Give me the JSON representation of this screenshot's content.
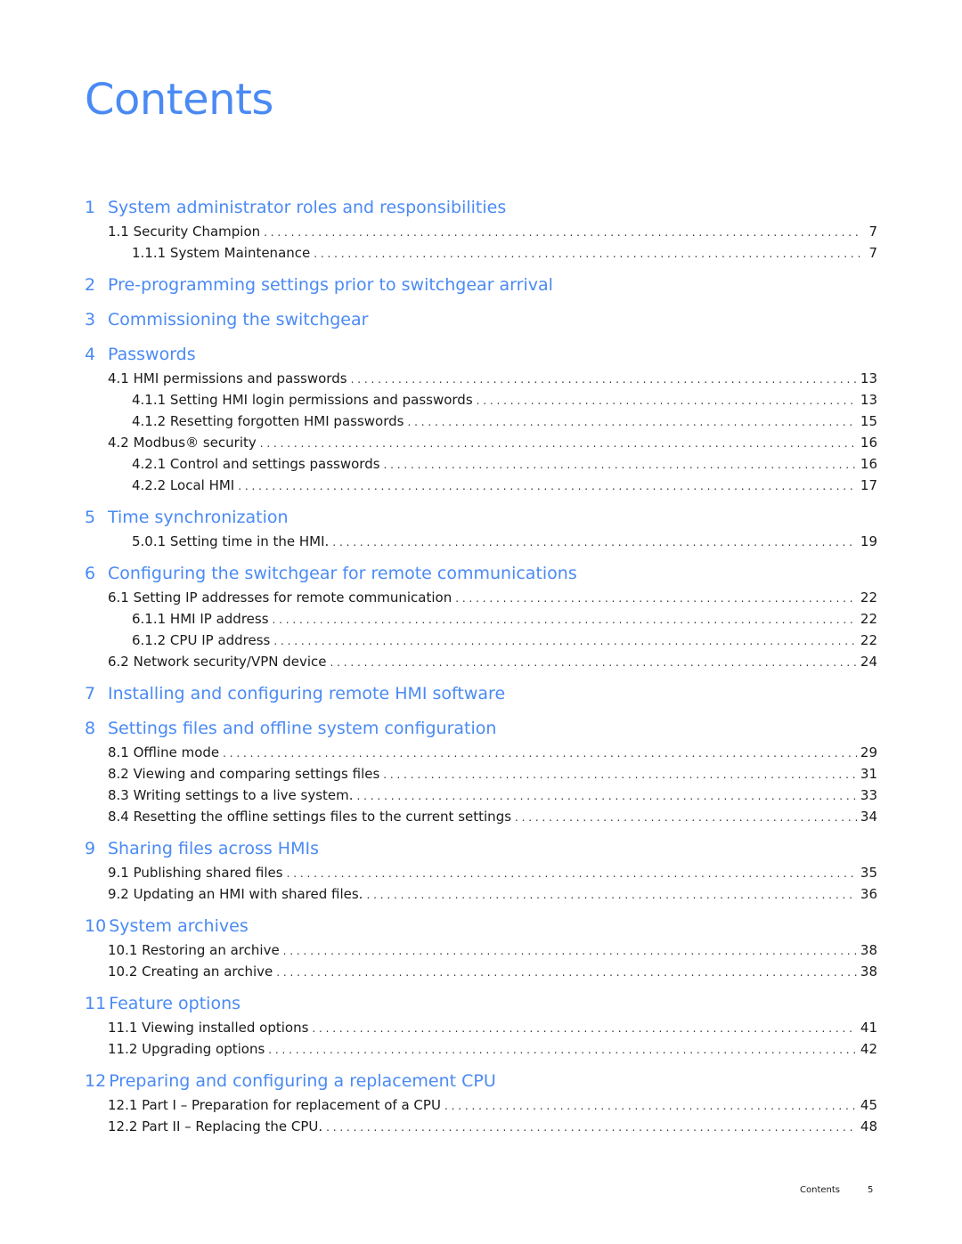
{
  "page_title": "Contents",
  "toc": [
    {
      "num": "1",
      "title": "System administrator roles and responsibilities",
      "entries": [
        {
          "level": 2,
          "label": "1.1 Security Champion",
          "page": "7"
        },
        {
          "level": 3,
          "label": "1.1.1 System Maintenance",
          "page": "7"
        }
      ]
    },
    {
      "num": "2",
      "title": "Pre-programming settings prior to switchgear arrival",
      "entries": []
    },
    {
      "num": "3",
      "title": "Commissioning the switchgear",
      "entries": []
    },
    {
      "num": "4",
      "title": "Passwords",
      "entries": [
        {
          "level": 2,
          "label": "4.1 HMI permissions and passwords",
          "page": "13"
        },
        {
          "level": 3,
          "label": "4.1.1 Setting HMI login permissions and passwords",
          "page": "13"
        },
        {
          "level": 3,
          "label": "4.1.2 Resetting forgotten HMI passwords",
          "page": "15"
        },
        {
          "level": 2,
          "label": "4.2 Modbus® security",
          "page": "16"
        },
        {
          "level": 3,
          "label": "4.2.1 Control and settings passwords",
          "page": "16"
        },
        {
          "level": 3,
          "label": "4.2.2 Local HMI",
          "page": "17"
        }
      ]
    },
    {
      "num": "5",
      "title": "Time synchronization",
      "entries": [
        {
          "level": 3,
          "label": "5.0.1 Setting time in the HMI.",
          "page": "19"
        }
      ]
    },
    {
      "num": "6",
      "title": "Configuring the switchgear for remote communications",
      "entries": [
        {
          "level": 2,
          "label": "6.1 Setting IP addresses for remote communication",
          "page": "22"
        },
        {
          "level": 3,
          "label": "6.1.1 HMI IP address",
          "page": "22"
        },
        {
          "level": 3,
          "label": "6.1.2 CPU IP address",
          "page": "22"
        },
        {
          "level": 2,
          "label": "6.2 Network security/VPN device",
          "page": "24"
        }
      ]
    },
    {
      "num": "7",
      "title": "Installing and configuring remote HMI software",
      "entries": []
    },
    {
      "num": "8",
      "title": "Settings files and offline system configuration",
      "entries": [
        {
          "level": 2,
          "label": "8.1 Offline mode",
          "page": "29"
        },
        {
          "level": 2,
          "label": "8.2 Viewing and comparing settings files",
          "page": "31"
        },
        {
          "level": 2,
          "label": "8.3 Writing settings to a live system.",
          "page": "33"
        },
        {
          "level": 2,
          "label": "8.4 Resetting the offline settings files to the current settings",
          "page": "34"
        }
      ]
    },
    {
      "num": "9",
      "title": "Sharing files across HMIs",
      "entries": [
        {
          "level": 2,
          "label": "9.1 Publishing shared files",
          "page": "35"
        },
        {
          "level": 2,
          "label": "9.2 Updating an HMI with shared files.",
          "page": "36"
        }
      ]
    },
    {
      "num": "10",
      "title": "System archives",
      "entries": [
        {
          "level": 2,
          "label": "10.1 Restoring an archive",
          "page": "38"
        },
        {
          "level": 2,
          "label": "10.2 Creating an archive",
          "page": "38"
        }
      ]
    },
    {
      "num": "11",
      "title": "Feature options",
      "entries": [
        {
          "level": 2,
          "label": "11.1 Viewing installed options",
          "page": "41"
        },
        {
          "level": 2,
          "label": "11.2 Upgrading options",
          "page": "42"
        }
      ]
    },
    {
      "num": "12",
      "title": "Preparing and configuring a replacement CPU",
      "entries": [
        {
          "level": 2,
          "label": "12.1 Part I – Preparation for replacement of a CPU",
          "page": "45"
        },
        {
          "level": 2,
          "label": "12.2 Part II – Replacing the CPU.",
          "page": "48"
        }
      ]
    }
  ],
  "footer": {
    "section": "Contents",
    "page": "5"
  },
  "colors": {
    "heading": "#4a8af4",
    "text": "#1a1a1a"
  }
}
